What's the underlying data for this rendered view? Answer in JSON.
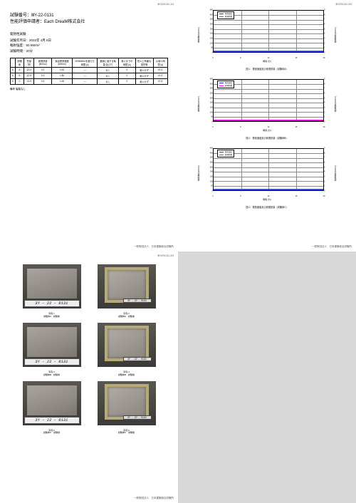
{
  "page1": {
    "pagenum": "ⅢY220131-1/3",
    "title_line1": "試験番号：ⅢY-22-0131",
    "title_line2": "性能評価申請者：Each DreaM株式会社",
    "heading": "発熱性試験",
    "meta1": "試験年月日：2022年 4月 6日",
    "meta2": "輻射強度：50 kW/m²",
    "meta3": "試験時間：20分",
    "table": {
      "headers": [
        "",
        "試験体",
        "質量 [g]",
        "総発熱量 [MJ/m²]",
        "最高発熱速度 [kW/m²]",
        "200kW/m²を超えた時間 [s]",
        "裏面に達する亀裂 及び穴",
        "着火までの時間 [s]",
        "防火上有害な変形等",
        "炎着火時間 [s]"
      ],
      "rows": [
        [
          "6",
          "A",
          "22.0",
          "0.1",
          "1.42",
          "—",
          "なし",
          "0",
          "着火せず",
          "ID:1"
        ],
        [
          "6",
          "B",
          "22.5",
          "0.9",
          "1.80",
          "—",
          "なし",
          "0",
          "着火せず",
          "ID:2"
        ],
        [
          "6",
          "C",
          "22.5",
          "0.4",
          "1.46",
          "—",
          "なし",
          "0",
          "着火せず",
          "ID:3"
        ]
      ]
    },
    "note": "備考 亀裂なし",
    "footer": "一般財団法人　日本建築総合試験所"
  },
  "page2": {
    "pagenum": "ⅢY220131-2/3",
    "caption1": "図-1　発熱速度及び総発熱量（試験体A）",
    "caption2": "図-2　発熱速度及び総発熱量（試験体B）",
    "caption3": "図-3　発熱速度及び総発熱量（試験体C）",
    "footer": "一般財団法人　日本建築総合試験所"
  },
  "page3": {
    "pagenum": "ⅢY220131-3/3",
    "strip": "3Y - 22 - 0131",
    "photos": [
      {
        "cap1": "写真-1",
        "cap2": "試験体A　試験前"
      },
      {
        "cap1": "写真-2",
        "cap2": "試験体A　試験後"
      },
      {
        "cap1": "写真-3",
        "cap2": "試験体B　試験前"
      },
      {
        "cap1": "写真-4",
        "cap2": "試験体B　試験後"
      },
      {
        "cap1": "写真-5",
        "cap2": "試験体C　試験前"
      },
      {
        "cap1": "写真-6",
        "cap2": "試験体C　試験後"
      }
    ],
    "footer": "一般財団法人　日本建築総合試験所"
  },
  "chart_data": [
    {
      "type": "line",
      "title": "発熱速度及び総発熱量（試験体A）",
      "xlabel": "時間 (分)",
      "ylabel_left": "発熱速度 (kW/m²)",
      "ylabel_right": "総発熱量 (MJ/m²)",
      "xlim": [
        0,
        20
      ],
      "ylim_left": [
        0,
        450
      ],
      "ylim_right": [
        0,
        9
      ],
      "x": [
        0,
        5,
        10,
        15,
        20
      ],
      "series": [
        {
          "name": "発熱速度",
          "color": "#2030ff",
          "values": [
            0,
            0,
            0,
            0,
            0
          ]
        },
        {
          "name": "総発熱量",
          "color": "#ff00ff",
          "values": [
            0,
            0.05,
            0.07,
            0.09,
            0.1
          ]
        }
      ]
    },
    {
      "type": "line",
      "title": "発熱速度及び総発熱量（試験体B）",
      "xlabel": "時間 (分)",
      "ylabel_left": "発熱速度 (kW/m²)",
      "ylabel_right": "総発熱量 (MJ/m²)",
      "xlim": [
        0,
        20
      ],
      "ylim_left": [
        0,
        450
      ],
      "ylim_right": [
        0,
        9
      ],
      "x": [
        0,
        5,
        10,
        15,
        20
      ],
      "series": [
        {
          "name": "発熱速度",
          "color": "#2030ff",
          "values": [
            0,
            0,
            0,
            0,
            0
          ]
        },
        {
          "name": "総発熱量",
          "color": "#ff00ff",
          "values": [
            0,
            0.3,
            0.5,
            0.7,
            0.9
          ]
        }
      ]
    },
    {
      "type": "line",
      "title": "発熱速度及び総発熱量（試験体C）",
      "xlabel": "時間 (分)",
      "ylabel_left": "発熱速度 (kW/m²)",
      "ylabel_right": "総発熱量 (MJ/m²)",
      "xlim": [
        0,
        20
      ],
      "ylim_left": [
        0,
        450
      ],
      "ylim_right": [
        0,
        9
      ],
      "x": [
        0,
        5,
        10,
        15,
        20
      ],
      "series": [
        {
          "name": "発熱速度",
          "color": "#2030ff",
          "values": [
            0,
            0,
            0,
            0,
            0
          ]
        },
        {
          "name": "総発熱量",
          "color": "#ff00ff",
          "values": [
            0,
            0.1,
            0.2,
            0.3,
            0.4
          ]
        }
      ]
    }
  ],
  "chart_ui": {
    "legend1": "発熱速度",
    "legend2": "総発熱量",
    "xlabel": "時間 (分)",
    "ylabel_l": "発熱速度 (kW/m²)",
    "ylabel_r": "総発熱量 (MJ/m²)",
    "yticks_l": [
      "0",
      "50",
      "100",
      "150",
      "200",
      "250",
      "300",
      "350",
      "400",
      "450"
    ],
    "yticks_r": [
      "0",
      "1",
      "2",
      "3",
      "4",
      "5",
      "6",
      "7",
      "8",
      "9"
    ],
    "xticks": [
      "0",
      "5",
      "10",
      "15",
      "20"
    ]
  }
}
